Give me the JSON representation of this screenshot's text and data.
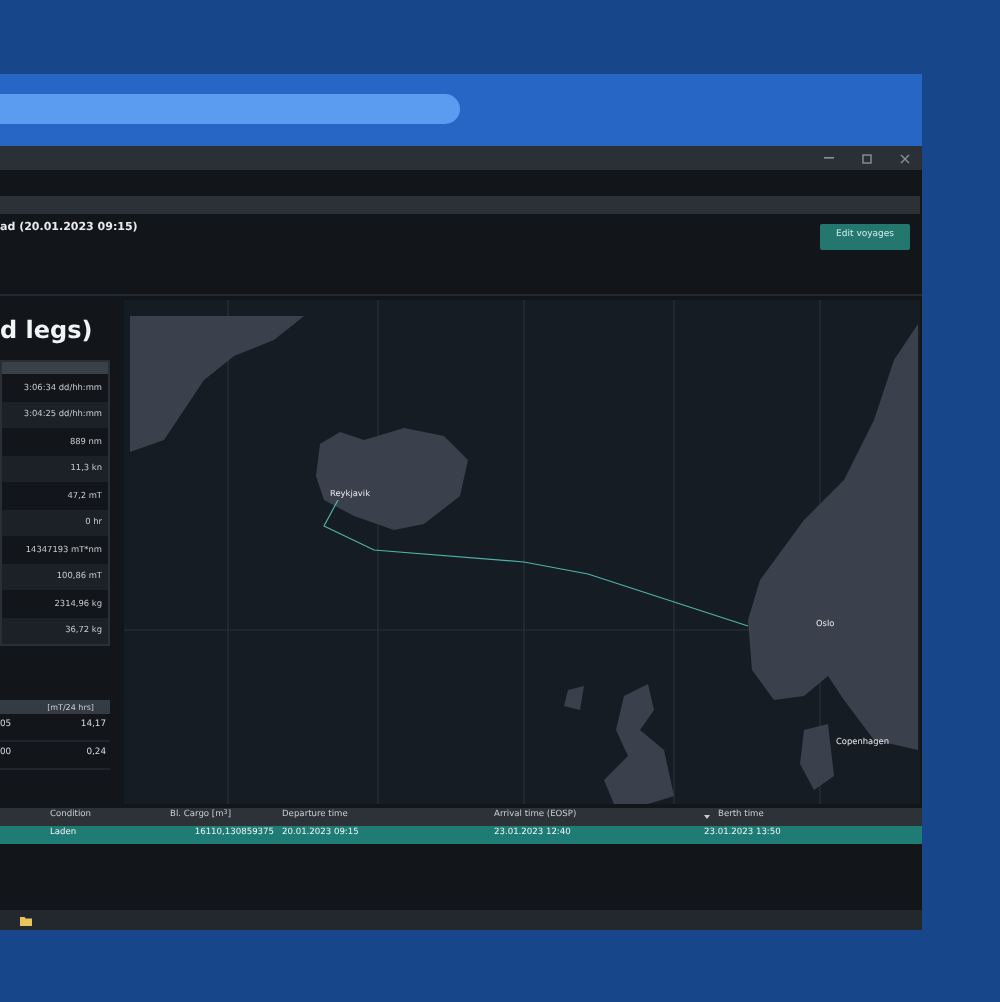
{
  "voyage_header": {
    "title": "ad (20.01.2023 09:15)",
    "button": "Edit voyages"
  },
  "legs_panel": {
    "title": "d legs)",
    "values": [
      "3:06:34 dd/hh:mm",
      "3:04:25 dd/hh:mm",
      "889 nm",
      "11,3 kn",
      "47,2 mT",
      "0 hr",
      "14347193 mT*nm",
      "100,86 mT",
      "2314,96 kg",
      "36,72 kg"
    ]
  },
  "consumption_table": {
    "header": "[mT/24 hrs]",
    "rows": [
      {
        "column_1": "05",
        "column_2": "14,17"
      },
      {
        "column_1": "00",
        "column_2": "0,24"
      }
    ]
  },
  "map": {
    "labels": [
      {
        "text": "Reykjavik"
      },
      {
        "text": "Oslo"
      },
      {
        "text": "Copenhagen"
      }
    ]
  },
  "voyage_table": {
    "columns": [
      {
        "label": "Condition",
        "sorted": false
      },
      {
        "label": "Bl. Cargo [m$^{3}$]",
        "sorted": false
      },
      {
        "label": "Departure time",
        "sorted": false
      },
      {
        "label": "Arrival time (EOSP)",
        "sorted": false
      },
      {
        "label": "Berth time",
        "sorted": true
      }
    ],
    "rows": [
      {
        "selected": true,
        "cells": [
          "Laden",
          "16110,130859375",
          "20.01.2023 09:15",
          "23.01.2023 12:40",
          "23.01.2023 13:50"
        ]
      }
    ]
  }
}
